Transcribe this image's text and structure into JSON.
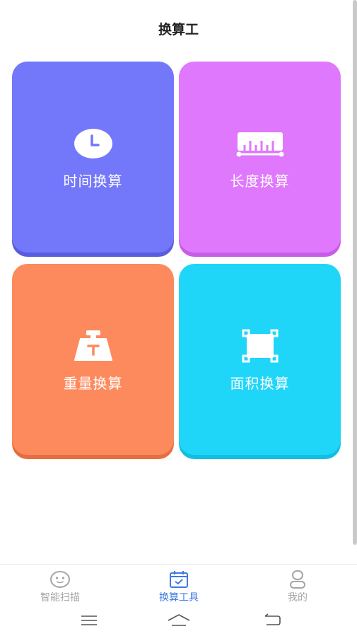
{
  "header": {
    "title": "换算工"
  },
  "cards": [
    {
      "label": "时间换算",
      "icon": "clock-icon",
      "color": "#7377f9"
    },
    {
      "label": "长度换算",
      "icon": "ruler-icon",
      "color": "#df78fc"
    },
    {
      "label": "重量换算",
      "icon": "weight-icon",
      "color": "#fd8a5c"
    },
    {
      "label": "面积换算",
      "icon": "area-icon",
      "color": "#1fd6f9"
    }
  ],
  "tabbar": {
    "items": [
      {
        "label": "智能扫描",
        "icon": "scan-face-icon",
        "active": false
      },
      {
        "label": "换算工具",
        "icon": "calendar-check-icon",
        "active": true
      },
      {
        "label": "我的",
        "icon": "profile-icon",
        "active": false
      }
    ],
    "active_color": "#3d7ae0",
    "inactive_color": "#a5a5a5"
  },
  "system_nav": {
    "buttons": [
      "menu-icon",
      "home-icon",
      "back-icon"
    ]
  }
}
